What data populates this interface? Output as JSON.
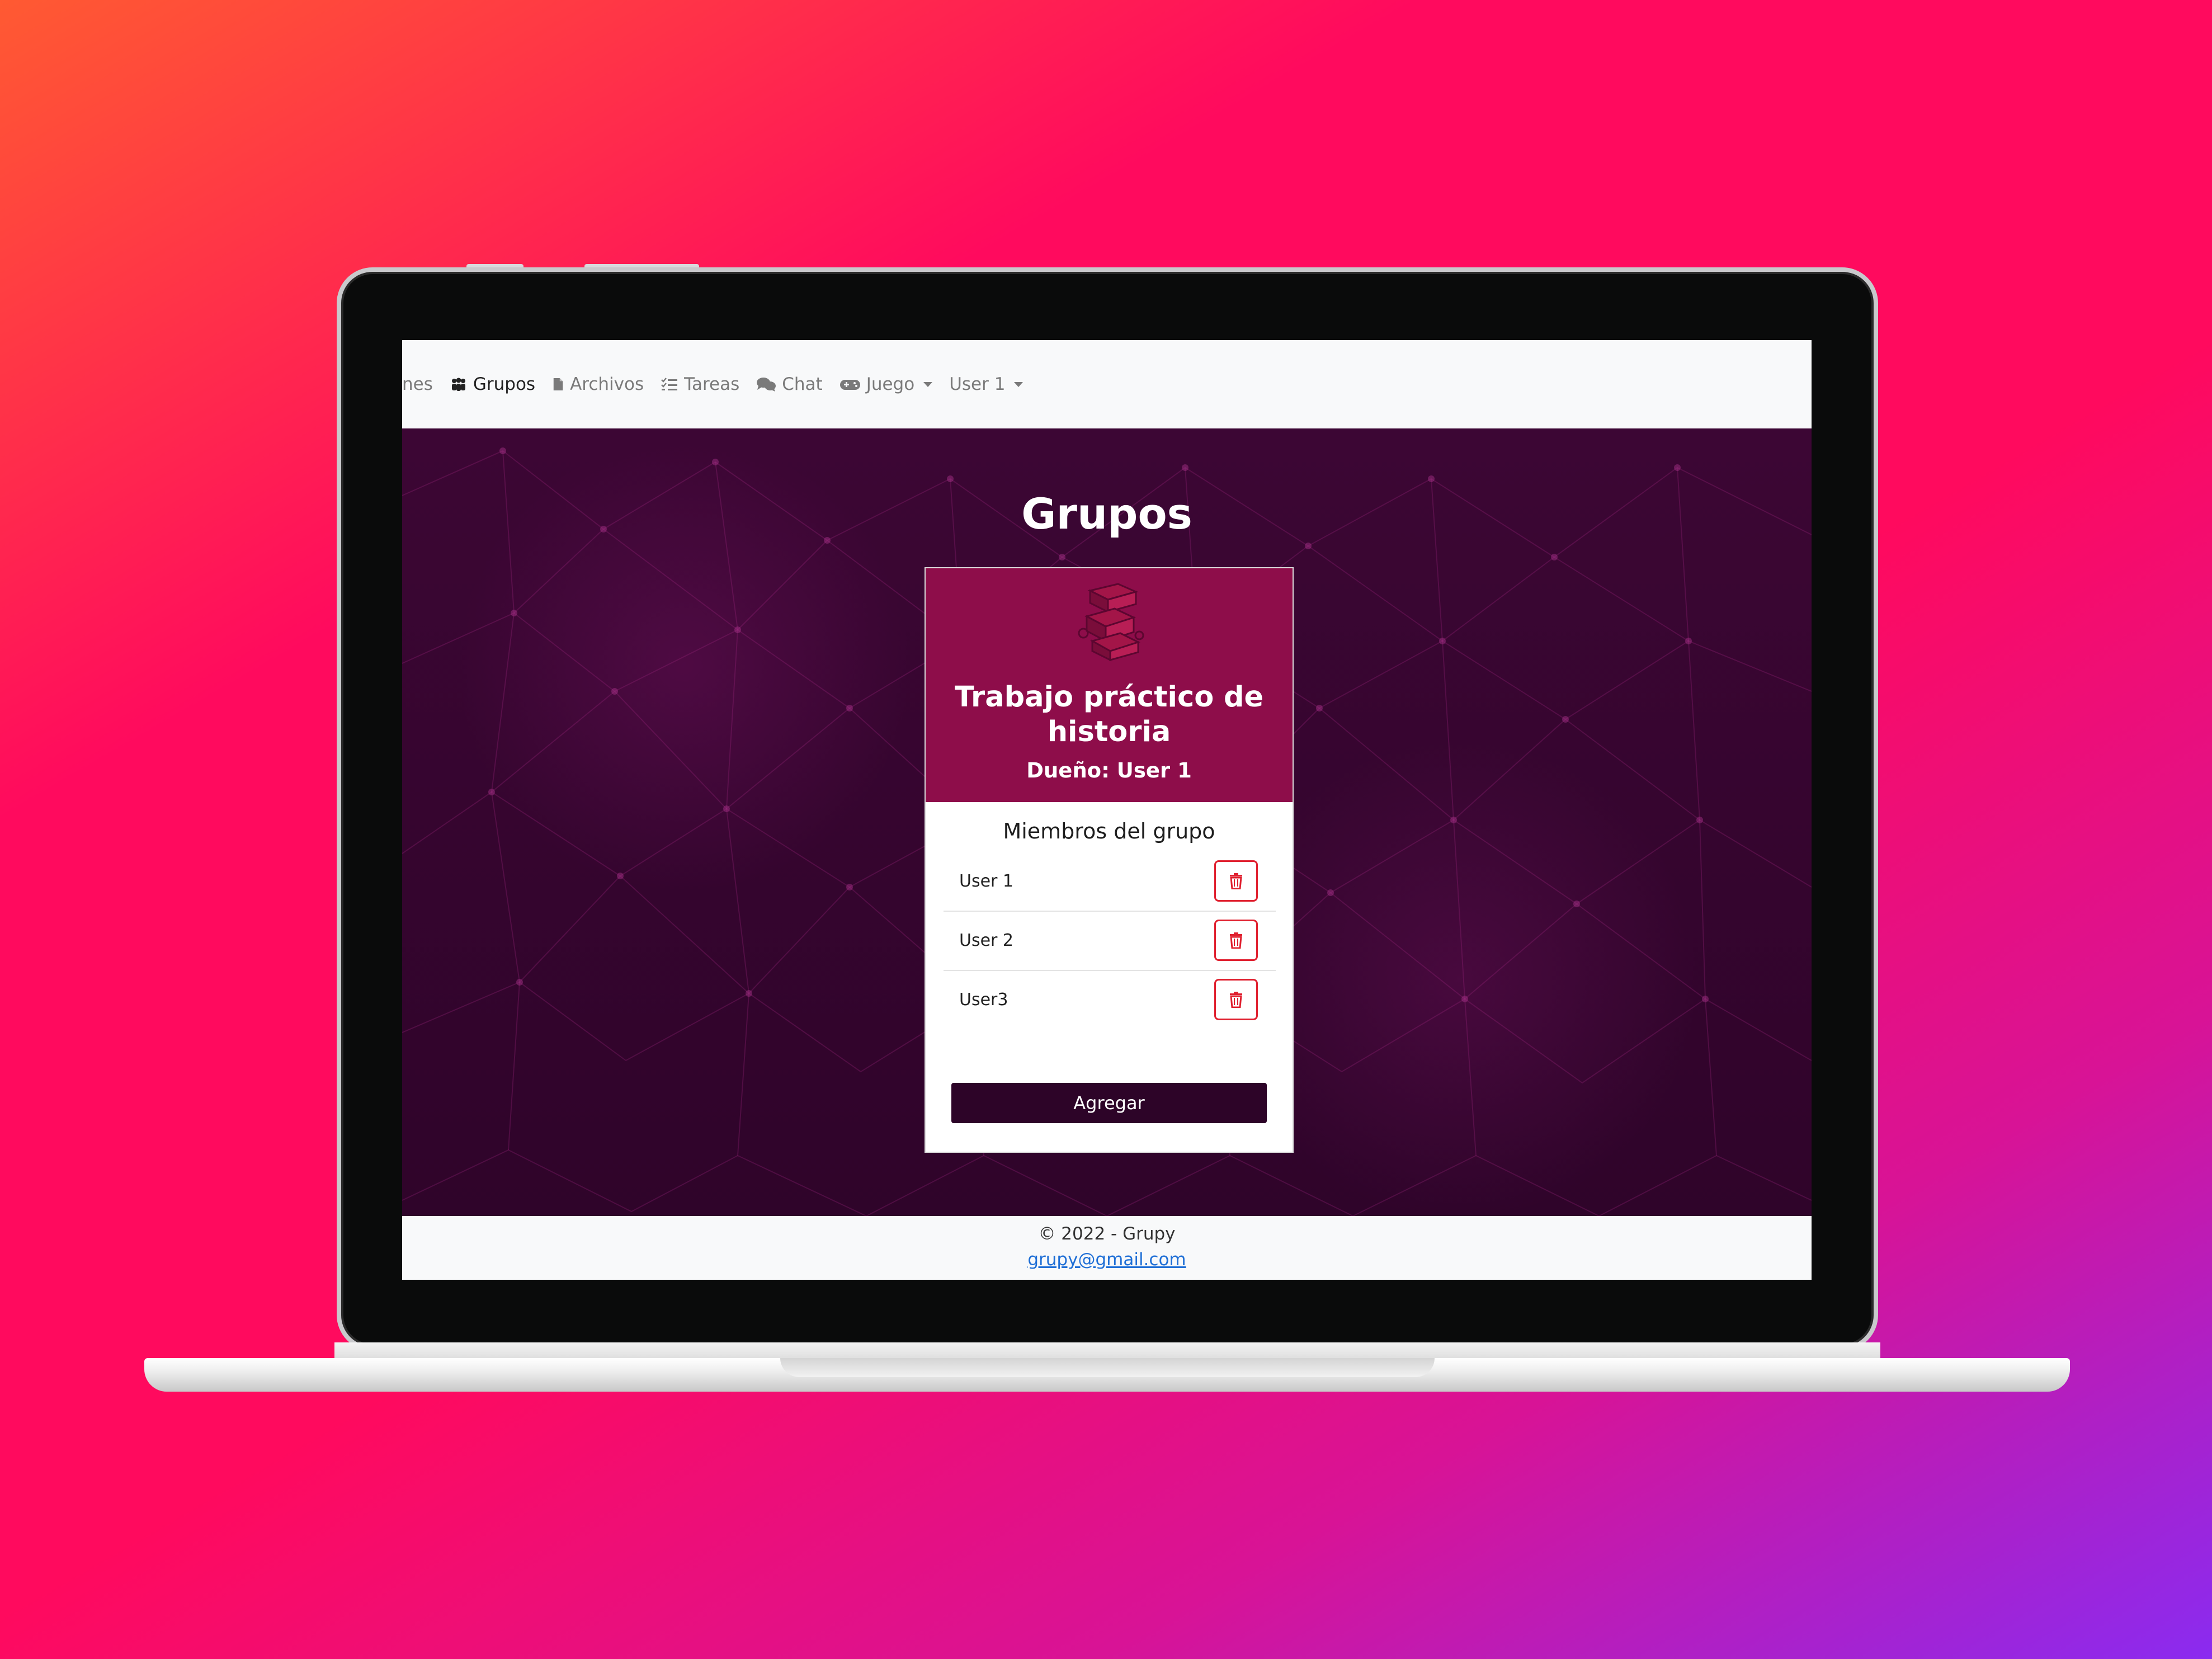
{
  "navbar": {
    "partial_item": "nes",
    "items": [
      {
        "label": "Grupos",
        "icon": "users-icon",
        "active": true
      },
      {
        "label": "Archivos",
        "icon": "file-icon",
        "active": false
      },
      {
        "label": "Tareas",
        "icon": "task-list-icon",
        "active": false
      },
      {
        "label": "Chat",
        "icon": "chat-icon",
        "active": false
      },
      {
        "label": "Juego",
        "icon": "gamepad-icon",
        "active": false,
        "dropdown": true
      },
      {
        "label": "User 1",
        "active": false,
        "dropdown": true
      }
    ]
  },
  "page": {
    "title": "Grupos"
  },
  "group_card": {
    "icon": "stacked-books-icon",
    "title": "Trabajo práctico de historia",
    "owner": "Dueño: User 1",
    "members_title": "Miembros del grupo",
    "members": [
      {
        "name": "User 1"
      },
      {
        "name": "User 2"
      },
      {
        "name": "User3"
      }
    ],
    "add_label": "Agregar"
  },
  "footer": {
    "copyright": "© 2022 - Grupy",
    "email": "grupy@gmail.com"
  },
  "colors": {
    "card_header": "#8e0d4a",
    "background": "#3a0632",
    "delete_accent": "#e0202f",
    "add_button": "#2d0428"
  }
}
